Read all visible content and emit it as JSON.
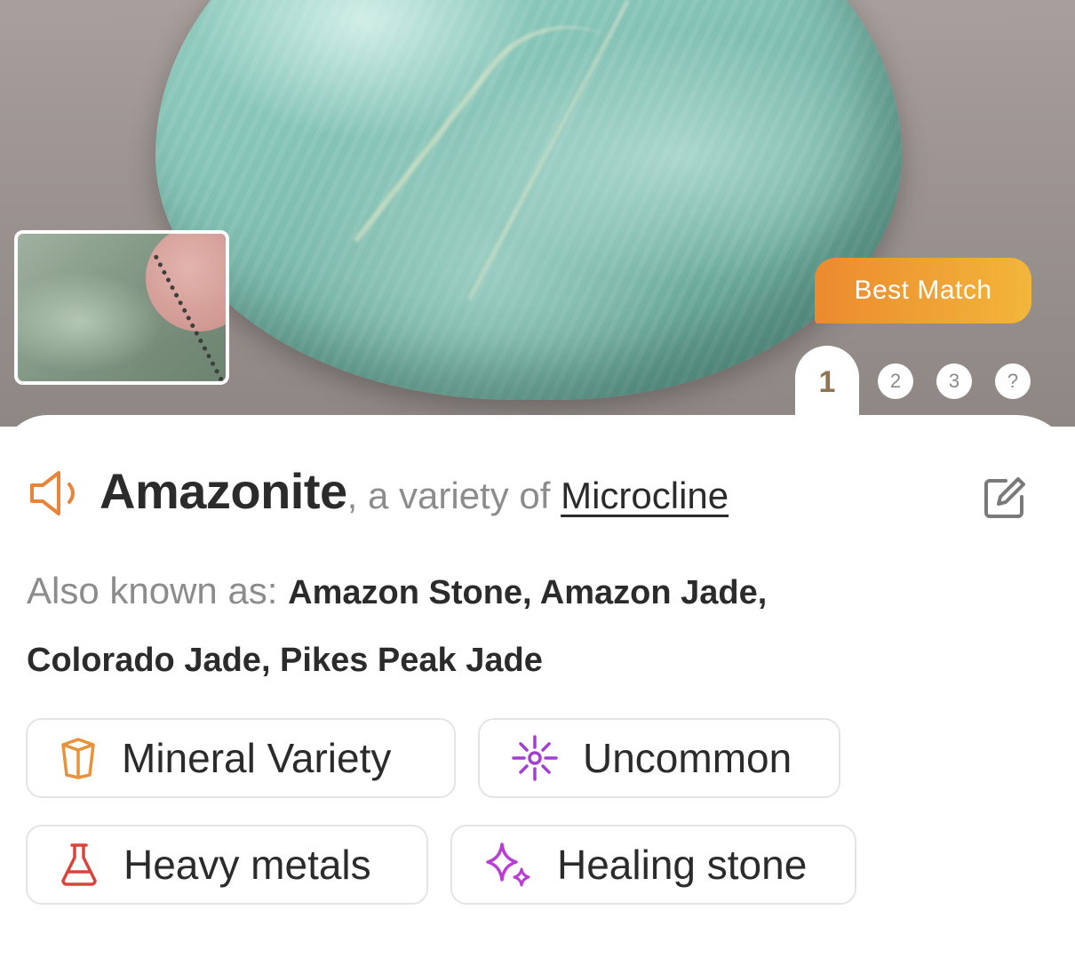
{
  "header": {
    "badge": "Best Match",
    "pages": [
      "1",
      "2",
      "3",
      "?"
    ],
    "active_page": "1"
  },
  "identification": {
    "name": "Amazonite",
    "variety_prefix": ", a variety of ",
    "variety_link": "Microcline"
  },
  "aliases": {
    "label": "Also known as: ",
    "values": "Amazon Stone, Amazon Jade, Colorado Jade, Pikes Peak Jade"
  },
  "tags": [
    {
      "label": "Mineral Variety",
      "icon": "gem-cube-icon",
      "color": "#e8923a"
    },
    {
      "label": "Uncommon",
      "icon": "sparkle-burst-icon",
      "color": "#a33fd0"
    },
    {
      "label": "Heavy metals",
      "icon": "flask-icon",
      "color": "#d9433a"
    },
    {
      "label": "Healing stone",
      "icon": "sparkles-icon",
      "color": "#b83fd6"
    }
  ],
  "colors": {
    "accent_orange": "#ec8a2f",
    "accent_gold": "#f2b63a",
    "active_page": "#8e7355",
    "muted_text": "#8c8c8c",
    "text": "#2b2b2b"
  }
}
